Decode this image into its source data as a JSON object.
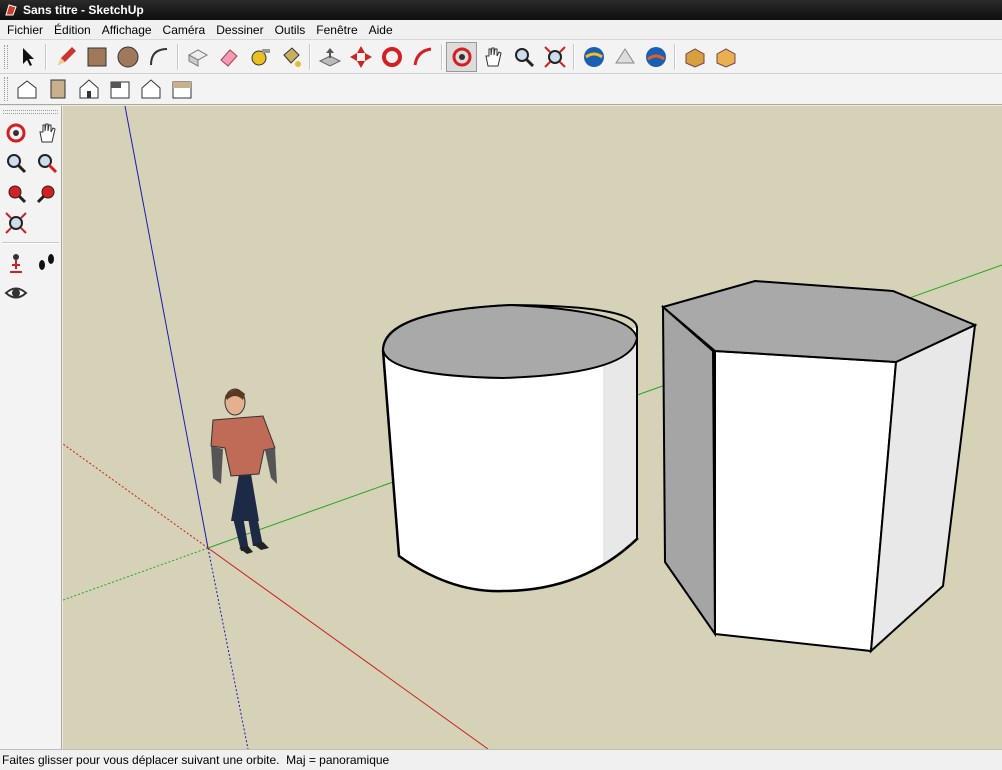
{
  "window": {
    "title": "Sans titre - SketchUp"
  },
  "menu": [
    {
      "label": "Fichier"
    },
    {
      "label": "Édition"
    },
    {
      "label": "Affichage"
    },
    {
      "label": "Caméra"
    },
    {
      "label": "Dessiner"
    },
    {
      "label": "Outils"
    },
    {
      "label": "Fenêtre"
    },
    {
      "label": "Aide"
    }
  ],
  "toolbar_main": [
    "select-icon",
    "pencil-icon",
    "rectangle-icon",
    "circle-icon",
    "arc-icon",
    "make-component-icon",
    "eraser-icon",
    "tape-measure-icon",
    "paint-bucket-icon",
    "push-pull-icon",
    "move-icon",
    "rotate-icon",
    "follow-me-icon",
    "orbit-icon",
    "pan-icon",
    "zoom-icon",
    "zoom-extents-icon",
    "google-earth-icon",
    "place-model-icon",
    "get-location-icon",
    "get-models-icon",
    "share-model-icon"
  ],
  "toolbar_views": [
    "iso-view-icon",
    "top-view-icon",
    "front-view-icon",
    "right-view-icon",
    "back-view-icon",
    "left-view-icon"
  ],
  "sidebar_camera": [
    "orbit-icon",
    "pan-icon",
    "zoom-icon",
    "zoom-window-icon",
    "previous-view-icon",
    "next-view-icon",
    "zoom-extents-icon"
  ],
  "sidebar_walk": [
    "position-camera-icon",
    "walk-icon",
    "look-around-icon"
  ],
  "colors": {
    "background": "#d6d2b8",
    "axis_red": "#c81e1e",
    "axis_green": "#22a622",
    "axis_blue": "#1a1ab4",
    "face_front": "#ffffff",
    "face_top": "#a9a9a9"
  },
  "status": {
    "text": "Faites glisser pour vous déplacer suivant une orbite.  Maj = panoramique"
  }
}
